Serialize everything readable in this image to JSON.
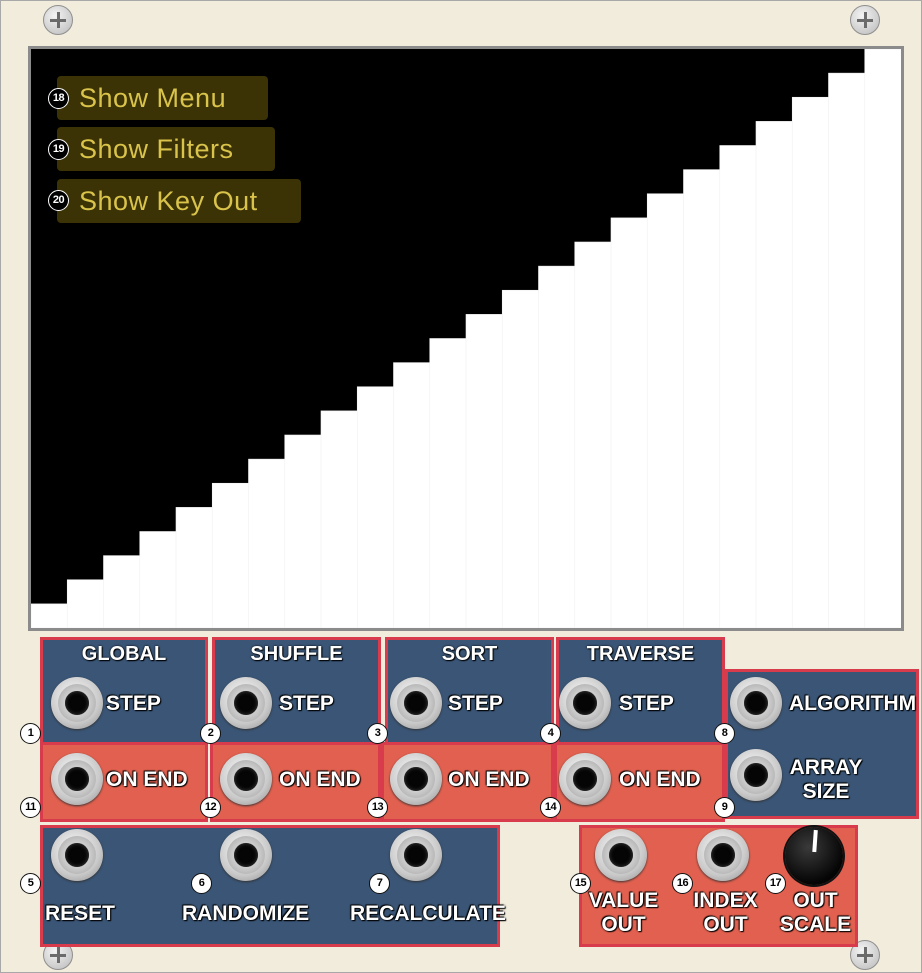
{
  "display": {
    "bar_count": 24,
    "menu_buttons": [
      {
        "num": "18",
        "label": "Show Menu"
      },
      {
        "num": "19",
        "label": "Show Filters"
      },
      {
        "num": "20",
        "label": "Show Key Out"
      }
    ]
  },
  "modules": {
    "global": {
      "header": "GLOBAL",
      "step_label": "STEP",
      "step_num": "1",
      "onend_label": "ON END",
      "onend_num": "11"
    },
    "shuffle": {
      "header": "SHUFFLE",
      "step_label": "STEP",
      "step_num": "2",
      "onend_label": "ON END",
      "onend_num": "12"
    },
    "sort": {
      "header": "SORT",
      "step_label": "STEP",
      "step_num": "3",
      "onend_label": "ON END",
      "onend_num": "13"
    },
    "traverse": {
      "header": "TRAVERSE",
      "step_label": "STEP",
      "step_num": "4",
      "onend_label": "ON END",
      "onend_num": "14"
    }
  },
  "inputs_right": {
    "algorithm_label": "ALGORITHM",
    "algorithm_num": "8",
    "array_size_line1": "ARRAY",
    "array_size_line2": "SIZE",
    "array_size_num": "9"
  },
  "triggers": {
    "reset_label": "RESET",
    "reset_num": "5",
    "randomize_label": "RANDOMIZE",
    "randomize_num": "6",
    "recalculate_label": "RECALCULATE",
    "recalculate_num": "7"
  },
  "outputs": {
    "value_line1": "VALUE",
    "value_line2": "OUT",
    "value_num": "15",
    "index_line1": "INDEX",
    "index_line2": "OUT",
    "index_num": "16",
    "scale_line1": "OUT",
    "scale_line2": "SCALE",
    "scale_num": "17"
  },
  "colors": {
    "accent_red": "#e2604f",
    "module_blue": "#3a5576",
    "menu_text": "#d9c34a"
  }
}
